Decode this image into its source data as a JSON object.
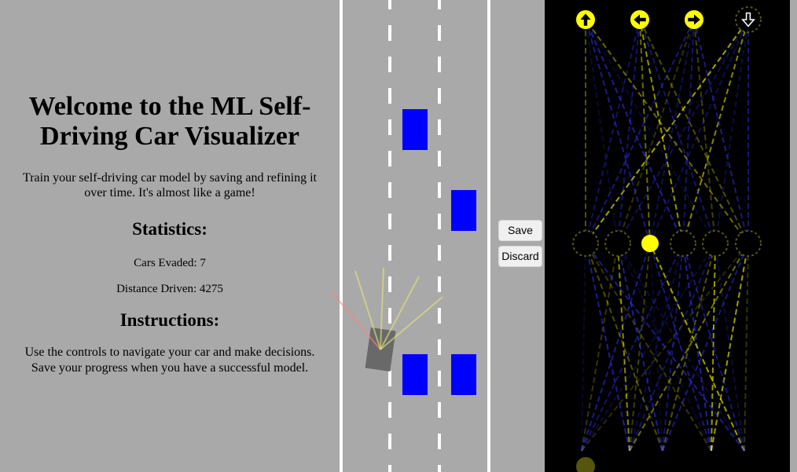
{
  "info": {
    "title": "Welcome to the ML Self-Driving Car Visualizer",
    "intro": "Train your self-driving car model by saving and refining it over time. It's almost like a game!",
    "statistics_heading": "Statistics:",
    "cars_evaded_label": "Cars Evaded: 7",
    "distance_label": "Distance Driven: 4275",
    "instructions_heading": "Instructions:",
    "instructions_text": "Use the controls to navigate your car and make decisions. Save your progress when you have a successful model."
  },
  "stats": {
    "cars_evaded": 7,
    "distance_driven": 4275
  },
  "controls": {
    "save_label": "Save",
    "discard_label": "Discard"
  },
  "colors": {
    "background": "#a9a9a9",
    "lane_line": "#ffffff",
    "traffic_car": "#0000ff",
    "player_car": "#696969",
    "sensor_ray": "#e6e67a",
    "sensor_ray_hit": "#ff8080",
    "network_bg": "#000000",
    "active_node": "#ffff00",
    "positive_weight": "#ffff00",
    "negative_weight": "#3333ff"
  },
  "road": {
    "lane_count": 3,
    "traffic": [
      {
        "lane": 1,
        "id": "traffic-car-1"
      },
      {
        "lane": 2,
        "id": "traffic-car-2"
      },
      {
        "lane": 1,
        "id": "traffic-car-3"
      },
      {
        "lane": 2,
        "id": "traffic-car-4"
      }
    ],
    "sensor_count": 5
  },
  "network": {
    "output_icons": [
      {
        "name": "arrow-up-icon",
        "active": true
      },
      {
        "name": "arrow-left-icon",
        "active": true
      },
      {
        "name": "arrow-right-icon",
        "active": true
      },
      {
        "name": "arrow-down-icon",
        "active": false
      }
    ],
    "hidden_activations": [
      0.0,
      0.0,
      1.0,
      0.0,
      0.0,
      0.0
    ],
    "input_activations": [
      0.35,
      0.0,
      0.0,
      0.0,
      0.0
    ]
  }
}
